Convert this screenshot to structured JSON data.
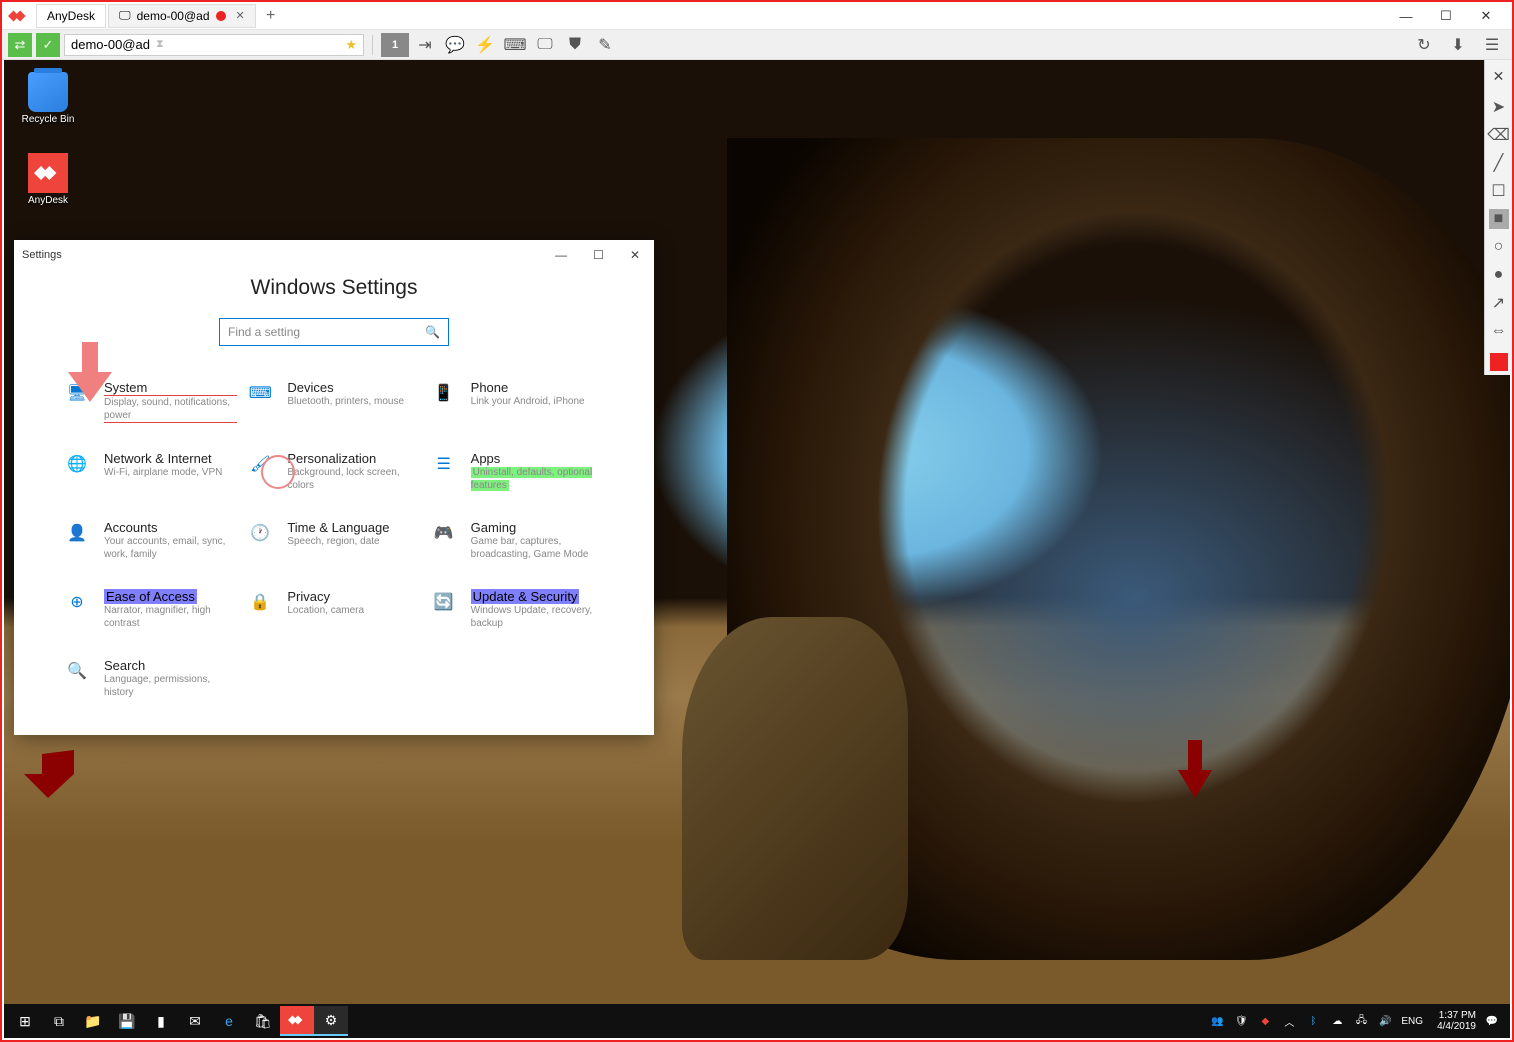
{
  "anydesk": {
    "app_name": "AnyDesk",
    "active_tab": "demo-00@ad",
    "address": "demo-00@ad",
    "monitor_number": "1"
  },
  "desktop": {
    "icons": [
      {
        "label": "Recycle Bin"
      },
      {
        "label": "AnyDesk"
      }
    ]
  },
  "settings": {
    "window_label": "Settings",
    "title": "Windows Settings",
    "search_placeholder": "Find a setting",
    "items": [
      {
        "name": "System",
        "desc": "Display, sound, notifications, power"
      },
      {
        "name": "Devices",
        "desc": "Bluetooth, printers, mouse"
      },
      {
        "name": "Phone",
        "desc": "Link your Android, iPhone"
      },
      {
        "name": "Network & Internet",
        "desc": "Wi-Fi, airplane mode, VPN"
      },
      {
        "name": "Personalization",
        "desc": "Background, lock screen, colors"
      },
      {
        "name": "Apps",
        "desc": "Uninstall, defaults, optional features"
      },
      {
        "name": "Accounts",
        "desc": "Your accounts, email, sync, work, family"
      },
      {
        "name": "Time & Language",
        "desc": "Speech, region, date"
      },
      {
        "name": "Gaming",
        "desc": "Game bar, captures, broadcasting, Game Mode"
      },
      {
        "name": "Ease of Access",
        "desc": "Narrator, magnifier, high contrast"
      },
      {
        "name": "Privacy",
        "desc": "Location, camera"
      },
      {
        "name": "Update & Security",
        "desc": "Windows Update, recovery, backup"
      },
      {
        "name": "Search",
        "desc": "Language, permissions, history"
      }
    ]
  },
  "taskbar": {
    "lang": "ENG",
    "time": "1:37 PM",
    "date": "4/4/2019"
  }
}
